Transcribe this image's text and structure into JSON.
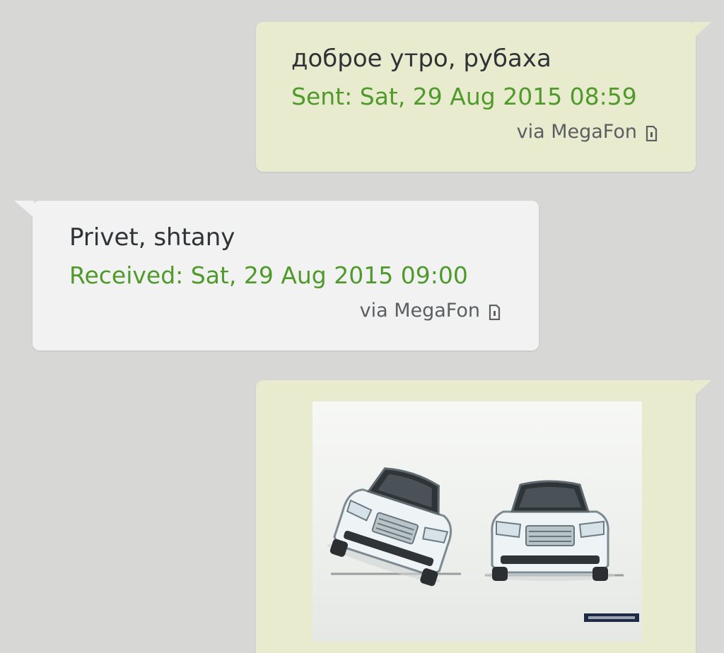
{
  "conversation": {
    "messages": [
      {
        "direction": "sent",
        "text": "доброе утро, рубаха",
        "status": "Sent: Sat, 29 Aug 2015 08:59",
        "via": "via MegaFon",
        "via_icon": "sim-card-icon"
      },
      {
        "direction": "received",
        "text": "Privet, shtany",
        "status": "Received: Sat, 29 Aug 2015 09:00",
        "via": "via MegaFon",
        "via_icon": "sim-card-icon"
      },
      {
        "direction": "sent",
        "attachment": {
          "type": "image",
          "content": "two-white-suvs-illustration"
        }
      }
    ]
  },
  "colors": {
    "background": "#d7d8d5",
    "sent_bubble": "#e9ebcf",
    "received_bubble": "#f1f2f1",
    "status_text": "#4f9a2a",
    "message_text": "#2e3436",
    "via_text": "#5b5f60"
  }
}
